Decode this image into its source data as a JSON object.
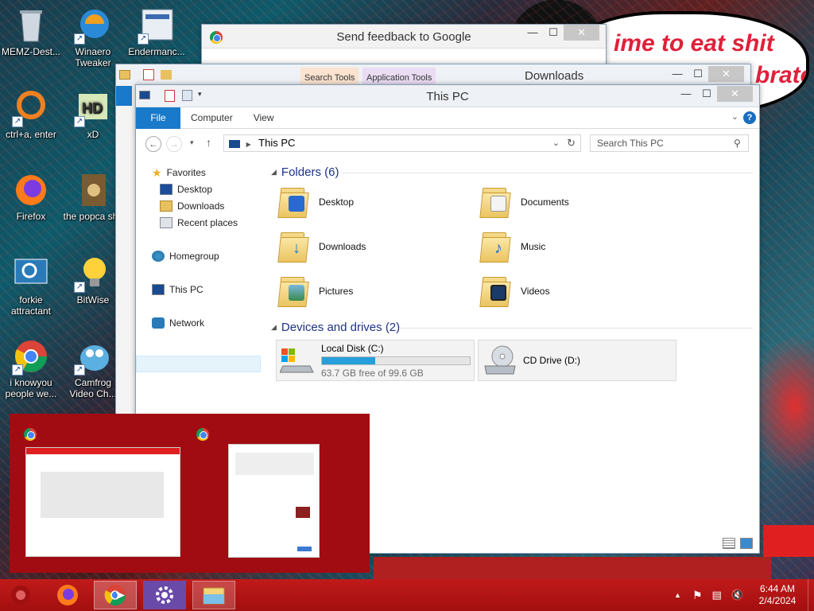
{
  "desktop": {
    "icons": [
      {
        "label": "MEMZ-Dest...",
        "icon": "recycle-bin-icon"
      },
      {
        "label": "Winaero Tweaker",
        "icon": "winaero-icon"
      },
      {
        "label": "Endermanc...",
        "icon": "document-icon"
      },
      {
        "label": "ctrl+a, enter",
        "icon": "ring-icon"
      },
      {
        "label": "xD",
        "icon": "hd-icon"
      },
      {
        "label": "Firefox",
        "icon": "firefox-icon"
      },
      {
        "label": "the popca shit",
        "icon": "media-icon"
      },
      {
        "label": "forkie attractant",
        "icon": "settings-icon"
      },
      {
        "label": "BitWise",
        "icon": "bulb-icon"
      },
      {
        "label": "i knowyou people we...",
        "icon": "chrome-icon"
      },
      {
        "label": "Camfrog Video Ch...",
        "icon": "camfrog-icon"
      }
    ],
    "overlay_text_1": "ime to eat shit",
    "overlay_text_2": "brate"
  },
  "feedback_window": {
    "title": "Send feedback to Google",
    "minimize": "—",
    "maximize": "☐",
    "close": "✕"
  },
  "downloads_window": {
    "title": "Downloads",
    "tab_search_tools": "Search Tools",
    "tab_application_tools": "Application Tools",
    "minimize": "—",
    "maximize": "☐",
    "close": "✕"
  },
  "explorer": {
    "title": "This PC",
    "minimize": "—",
    "maximize": "☐",
    "close": "✕",
    "tabs": {
      "file": "File",
      "computer": "Computer",
      "view": "View"
    },
    "address": "This PC",
    "search_placeholder": "Search This PC",
    "nav": {
      "favorites": "Favorites",
      "desktop": "Desktop",
      "downloads": "Downloads",
      "recent": "Recent places",
      "homegroup": "Homegroup",
      "this_pc": "This PC",
      "network": "Network"
    },
    "folders_header": "Folders (6)",
    "folders": [
      {
        "name": "Desktop",
        "icon": "desktop-folder-icon"
      },
      {
        "name": "Documents",
        "icon": "documents-folder-icon"
      },
      {
        "name": "Downloads",
        "icon": "downloads-folder-icon"
      },
      {
        "name": "Music",
        "icon": "music-folder-icon"
      },
      {
        "name": "Pictures",
        "icon": "pictures-folder-icon"
      },
      {
        "name": "Videos",
        "icon": "videos-folder-icon"
      }
    ],
    "drives_header": "Devices and drives (2)",
    "drives": [
      {
        "name": "Local Disk (C:)",
        "free": "63.7 GB free of 99.6 GB",
        "used_fraction": 0.36
      },
      {
        "name": "CD Drive (D:)"
      }
    ]
  },
  "taskbar": {
    "clock_time": "6:44 AM",
    "clock_date": "2/4/2024",
    "colors": {
      "taskbar": "#b31414",
      "accent": "#1979ca"
    }
  }
}
